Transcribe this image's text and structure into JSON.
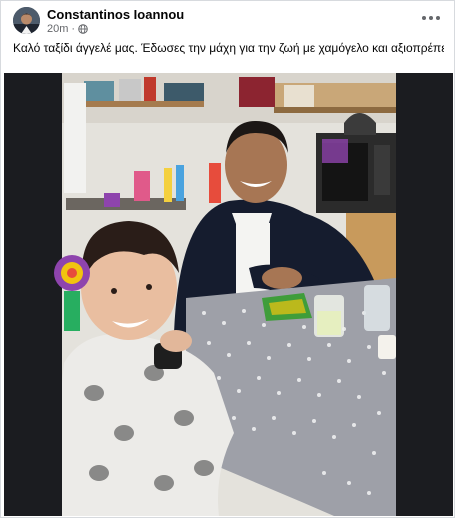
{
  "post": {
    "author_name": "Constantinos Ioannou",
    "timestamp": "20m",
    "separator": "·",
    "privacy_icon": "globe-icon",
    "more_icon": "more-options-icon",
    "caption": "Καλό ταξίδι άγγελέ μας. Έδωσες την μάχη για την ζωή με χαμόγελο και αξιοπρέπεια. Οι σκέψεις μας μαζί σας."
  },
  "photo": {
    "description_icon": "photo"
  }
}
